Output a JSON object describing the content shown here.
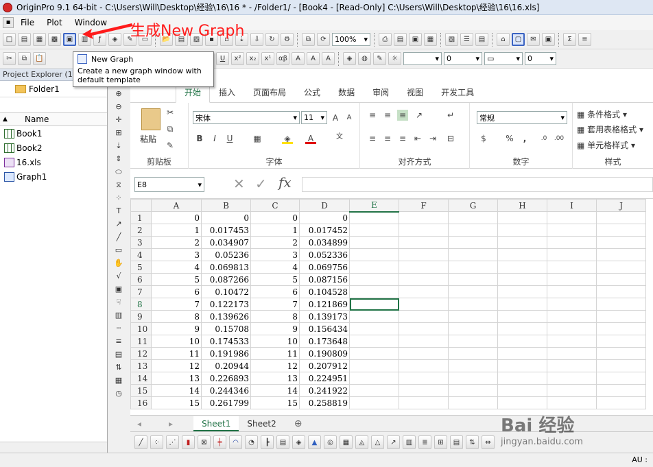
{
  "titlebar": {
    "text": "OriginPro 9.1 64-bit - C:\\Users\\Will\\Desktop\\经验\\16\\16 * - /Folder1/ - [Book4 - [Read-Only] C:\\Users\\Will\\Desktop\\经验\\16\\16.xls]"
  },
  "menu": {
    "items": [
      "File",
      "Plot",
      "Window"
    ]
  },
  "annotation": {
    "text": "生成New Graph",
    "color": "#ff1b1b"
  },
  "toolbar": {
    "zoom": "100%"
  },
  "toolbar2": {
    "combo1": "",
    "combo2": "0",
    "combo3": "0"
  },
  "tooltip": {
    "title": "New Graph",
    "desc": "Create a new graph window with default template"
  },
  "explorer": {
    "title": "Project Explorer (1)",
    "folder": "Folder1",
    "column": "Name",
    "items": [
      {
        "label": "Book1",
        "icon": "workbook-icon"
      },
      {
        "label": "Book2",
        "icon": "workbook-icon"
      },
      {
        "label": "16.xls",
        "icon": "excel-file-icon"
      },
      {
        "label": "Graph1",
        "icon": "graph-icon"
      }
    ]
  },
  "excel": {
    "tabs": [
      "开始",
      "插入",
      "页面布局",
      "公式",
      "数据",
      "审阅",
      "视图",
      "开发工具"
    ],
    "ribbon": {
      "clipboard": {
        "paste": "粘贴",
        "label": "剪贴板"
      },
      "font": {
        "name": "宋体",
        "size": "11",
        "label": "字体",
        "bold": "B",
        "italic": "I",
        "underline": "U"
      },
      "alignment": {
        "label": "对齐方式"
      },
      "number": {
        "format": "常规",
        "label": "数字",
        "percent": "%",
        "comma": ","
      },
      "styles": {
        "label": "样式",
        "cond": "条件格式",
        "table": "套用表格格式",
        "cell": "单元格样式"
      }
    },
    "formula_bar": {
      "namebox": "E8",
      "fx": "fx",
      "value": ""
    },
    "columns": [
      "A",
      "B",
      "C",
      "D",
      "E",
      "F",
      "G",
      "H",
      "I",
      "J"
    ],
    "selected_column": "E",
    "selected_row": "8",
    "rows": [
      [
        "1",
        "0",
        "0",
        "0",
        "0"
      ],
      [
        "2",
        "1",
        "0.017453",
        "1",
        "0.017452"
      ],
      [
        "3",
        "2",
        "0.034907",
        "2",
        "0.034899"
      ],
      [
        "4",
        "3",
        "0.05236",
        "3",
        "0.052336"
      ],
      [
        "5",
        "4",
        "0.069813",
        "4",
        "0.069756"
      ],
      [
        "6",
        "5",
        "0.087266",
        "5",
        "0.087156"
      ],
      [
        "7",
        "6",
        "0.10472",
        "6",
        "0.104528"
      ],
      [
        "8",
        "7",
        "0.122173",
        "7",
        "0.121869"
      ],
      [
        "9",
        "8",
        "0.139626",
        "8",
        "0.139173"
      ],
      [
        "10",
        "9",
        "0.15708",
        "9",
        "0.156434"
      ],
      [
        "11",
        "10",
        "0.174533",
        "10",
        "0.173648"
      ],
      [
        "12",
        "11",
        "0.191986",
        "11",
        "0.190809"
      ],
      [
        "13",
        "12",
        "0.20944",
        "12",
        "0.207912"
      ],
      [
        "14",
        "13",
        "0.226893",
        "13",
        "0.224951"
      ],
      [
        "15",
        "14",
        "0.244346",
        "14",
        "0.241922"
      ],
      [
        "16",
        "15",
        "0.261799",
        "15",
        "0.258819"
      ]
    ],
    "sheets": [
      "Sheet1",
      "Sheet2"
    ],
    "active_sheet": "Sheet1"
  },
  "status": {
    "right": "AU :"
  },
  "watermark": {
    "text": "Bai 经验",
    "sub": "jingyan.baidu.com"
  }
}
